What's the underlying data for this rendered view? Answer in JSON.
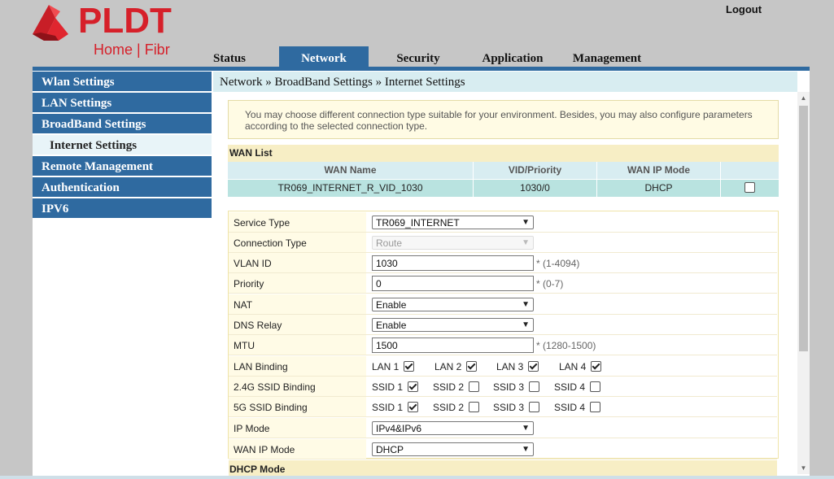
{
  "brand": {
    "name": "PLDT",
    "tagline": "Home | Fibr"
  },
  "header": {
    "logout_label": "Logout"
  },
  "tabs": [
    {
      "label": "Status",
      "active": false
    },
    {
      "label": "Network",
      "active": true
    },
    {
      "label": "Security",
      "active": false
    },
    {
      "label": "Application",
      "active": false
    },
    {
      "label": "Management",
      "active": false
    }
  ],
  "sidebar": {
    "items": [
      {
        "label": "Wlan Settings"
      },
      {
        "label": "LAN Settings"
      },
      {
        "label": "BroadBand Settings"
      },
      {
        "label": "Internet Settings",
        "selected": true
      },
      {
        "label": "Remote Management"
      },
      {
        "label": "Authentication"
      },
      {
        "label": "IPV6"
      }
    ]
  },
  "breadcrumb": "Network » BroadBand Settings » Internet Settings",
  "notice": {
    "line1": "You may choose different connection type suitable for your environment. Besides, you may also configure parameters",
    "line2": "according to the selected connection type."
  },
  "wan_list": {
    "title": "WAN List",
    "columns": [
      "WAN Name",
      "VID/Priority",
      "WAN IP Mode"
    ],
    "rows": [
      {
        "name": "TR069_INTERNET_R_VID_1030",
        "vid_priority": "1030/0",
        "ip_mode": "DHCP",
        "checked": false
      }
    ]
  },
  "form": {
    "service_type": {
      "label": "Service Type",
      "value": "TR069_INTERNET"
    },
    "connection_type": {
      "label": "Connection Type",
      "value": "Route",
      "disabled": true
    },
    "vlan_id": {
      "label": "VLAN ID",
      "value": "1030",
      "hint": "*  (1-4094)"
    },
    "priority": {
      "label": "Priority",
      "value": "0",
      "hint": "*  (0-7)"
    },
    "nat": {
      "label": "NAT",
      "value": "Enable"
    },
    "dns_relay": {
      "label": "DNS Relay",
      "value": "Enable"
    },
    "mtu": {
      "label": "MTU",
      "value": "1500",
      "hint": "* (1280-1500)"
    },
    "lan_binding": {
      "label": "LAN Binding",
      "options": [
        {
          "label": "LAN 1",
          "checked": true
        },
        {
          "label": "LAN 2",
          "checked": true
        },
        {
          "label": "LAN 3",
          "checked": true
        },
        {
          "label": "LAN 4",
          "checked": true
        }
      ]
    },
    "ssid_24g_binding": {
      "label": "2.4G SSID Binding",
      "options": [
        {
          "label": "SSID 1",
          "checked": true
        },
        {
          "label": "SSID 2",
          "checked": false
        },
        {
          "label": "SSID 3",
          "checked": false
        },
        {
          "label": "SSID 4",
          "checked": false
        }
      ]
    },
    "ssid_5g_binding": {
      "label": "5G SSID Binding",
      "options": [
        {
          "label": "SSID 1",
          "checked": true
        },
        {
          "label": "SSID 2",
          "checked": false
        },
        {
          "label": "SSID 3",
          "checked": false
        },
        {
          "label": "SSID 4",
          "checked": false
        }
      ]
    },
    "ip_mode": {
      "label": "IP Mode",
      "value": "IPv4&IPv6"
    },
    "wan_ip_mode": {
      "label": "WAN IP Mode",
      "value": "DHCP"
    }
  },
  "dhcp_section_title": "DHCP Mode",
  "colors": {
    "brand_red": "#d6202a",
    "nav_blue": "#2f6aa0"
  }
}
